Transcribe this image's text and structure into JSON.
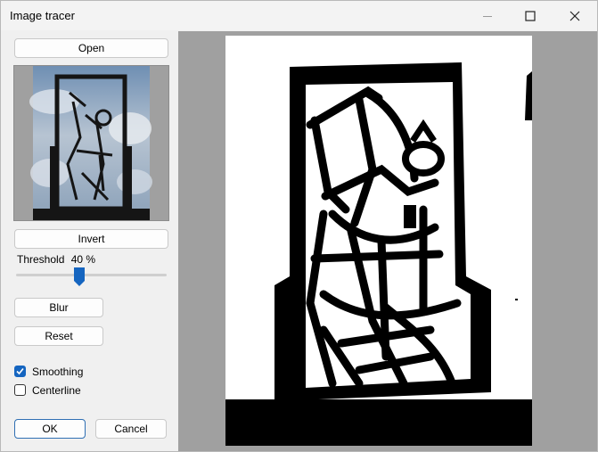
{
  "window": {
    "title": "Image tracer"
  },
  "buttons": {
    "open": "Open",
    "invert": "Invert",
    "blur": "Blur",
    "reset": "Reset",
    "ok": "OK",
    "cancel": "Cancel"
  },
  "threshold": {
    "label": "Threshold",
    "value_text": "40 %",
    "value": 40
  },
  "checkboxes": [
    {
      "label": "Smoothing",
      "checked": true
    },
    {
      "label": "Centerline",
      "checked": false
    }
  ],
  "icons": {
    "minimize": "minimize-icon",
    "maximize": "maximize-icon",
    "close": "close-icon",
    "check": "checkmark-icon"
  },
  "colors": {
    "accent": "#1565c0",
    "preview_bg": "#a0a0a0",
    "trace_fg": "#000000"
  }
}
